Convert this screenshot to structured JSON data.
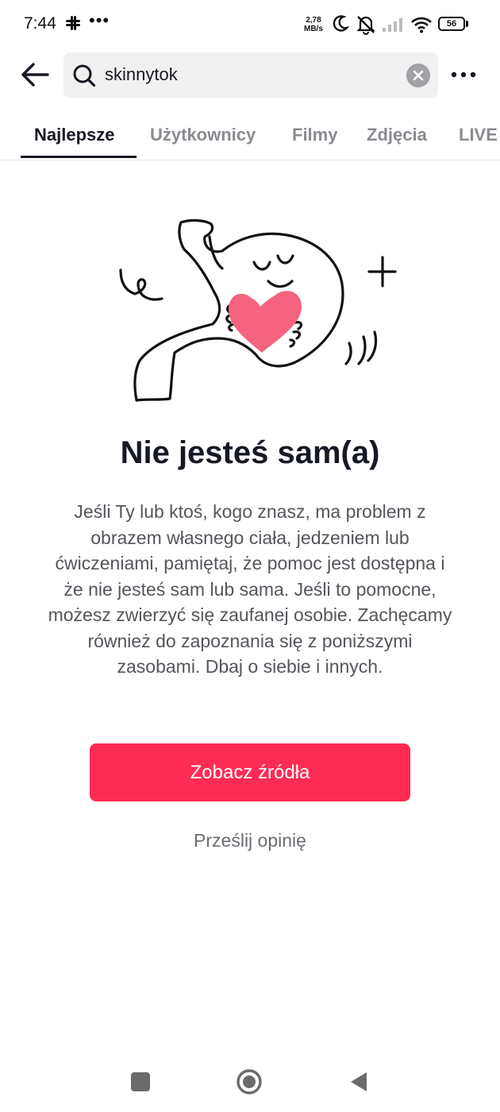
{
  "status_bar": {
    "time": "7:44",
    "net_speed_value": "2,78",
    "net_speed_unit": "MB/s",
    "battery": "56",
    "icons": [
      "slack-icon",
      "more-dots-icon",
      "moon-icon",
      "mute-icon",
      "signal-icon",
      "wifi-icon",
      "battery-icon"
    ]
  },
  "header": {
    "search_query": "skinnytok",
    "icons": [
      "back-arrow-icon",
      "search-icon",
      "clear-icon",
      "more-icon"
    ]
  },
  "tabs": [
    {
      "label": "Najlepsze",
      "active": true
    },
    {
      "label": "Użytkownicy",
      "active": false
    },
    {
      "label": "Filmy",
      "active": false
    },
    {
      "label": "Zdjęcia",
      "active": false
    },
    {
      "label": "LIVE",
      "active": false
    }
  ],
  "content": {
    "title": "Nie jesteś sam(a)",
    "body": "Jeśli Ty lub ktoś, kogo znasz, ma problem z obrazem własnego ciała, jedzeniem lub ćwiczeniami, pamiętaj, że pomoc jest dostępna i że nie jesteś sam lub sama. Jeśli to pomocne, możesz zwierzyć się zaufanej osobie. Zachęcamy również do zapoznania się z poniższymi zasobami. Dbaj o siebie i innych.",
    "primary_button": "Zobacz źródła",
    "feedback_link": "Prześlij opinię"
  },
  "colors": {
    "accent": "#fe2c55",
    "heart": "#f5637f",
    "text_primary": "#161823",
    "text_secondary": "#55565c"
  }
}
